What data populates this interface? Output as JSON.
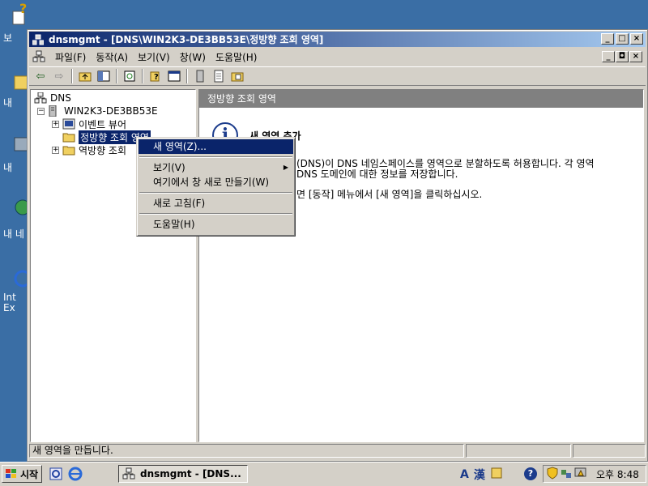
{
  "desktop": {
    "labels": [
      "보",
      "내",
      "내",
      "내 네",
      "Int",
      "Ex"
    ]
  },
  "window": {
    "title": "dnsmgmt - [DNS\\WIN2K3-DE3BB53E\\정방향 조회 영역]",
    "min": "_",
    "max": "□",
    "close": "×",
    "restore": "◘"
  },
  "menubar": {
    "items": [
      "파일(F)",
      "동작(A)",
      "보기(V)",
      "창(W)",
      "도움말(H)"
    ]
  },
  "tree": {
    "root": "DNS",
    "server": "WIN2K3-DE3BB53E",
    "event_viewer": "이벤트 뷰어",
    "forward_zone": "정방향 조회 영역",
    "reverse_zone": "역방향 조회"
  },
  "right": {
    "header": "정방향 조회 영역",
    "info_title": "새 영역 추가",
    "line1": "(DNS)이 DNS 네임스페이스를 영역으로 분할하도록 허용합니다. 각 영역",
    "line2": "DNS 도메인에 대한 정보를 저장합니다.",
    "line3": "면 [동작] 메뉴에서 [새 영역]을 클릭하십시오."
  },
  "context_menu": {
    "new_zone": "새 영역(Z)...",
    "view": "보기(V)",
    "new_window": "여기에서 창 새로 만들기(W)",
    "refresh": "새로 고침(F)",
    "help": "도움말(H)"
  },
  "statusbar": {
    "text": "새 영역을 만듭니다."
  },
  "taskbar": {
    "start": "시작",
    "task": "dnsmgmt - [DNS...",
    "lang_a": "A",
    "lang_han": "漢",
    "help": "?",
    "clock": "오후 8:48"
  },
  "colors": {
    "desktop": "#3a6ea5",
    "titlebar": "#0a246a",
    "highlight": "#0a246a"
  }
}
